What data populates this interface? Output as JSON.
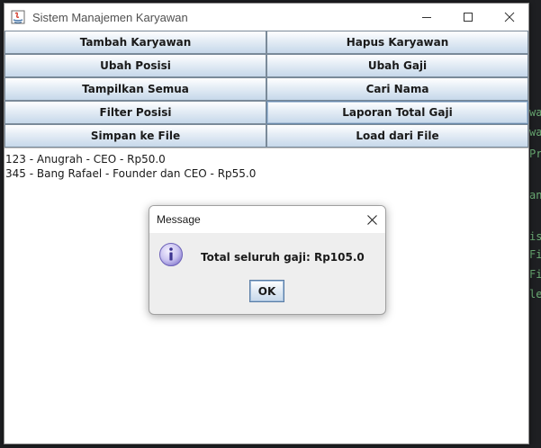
{
  "window": {
    "title": "Sistem Manajemen Karyawan"
  },
  "buttons": [
    "Tambah Karyawan",
    "Hapus Karyawan",
    "Ubah Posisi",
    "Ubah Gaji",
    "Tampilkan Semua",
    "Cari Nama",
    "Filter Posisi",
    "Laporan Total Gaji",
    "Simpan ke File",
    "Load dari File"
  ],
  "output": {
    "lines": [
      "123 - Anugrah - CEO - Rp50.0",
      "345 - Bang Rafael - Founder dan CEO - Rp55.0"
    ]
  },
  "dialog": {
    "title": "Message",
    "message": "Total seluruh gaji: Rp105.0",
    "ok_label": "OK",
    "icon": "info-icon"
  },
  "colors": {
    "button_top": "#ffffff",
    "button_bottom": "#c6d8ea",
    "code_green": "#6aab73"
  }
}
